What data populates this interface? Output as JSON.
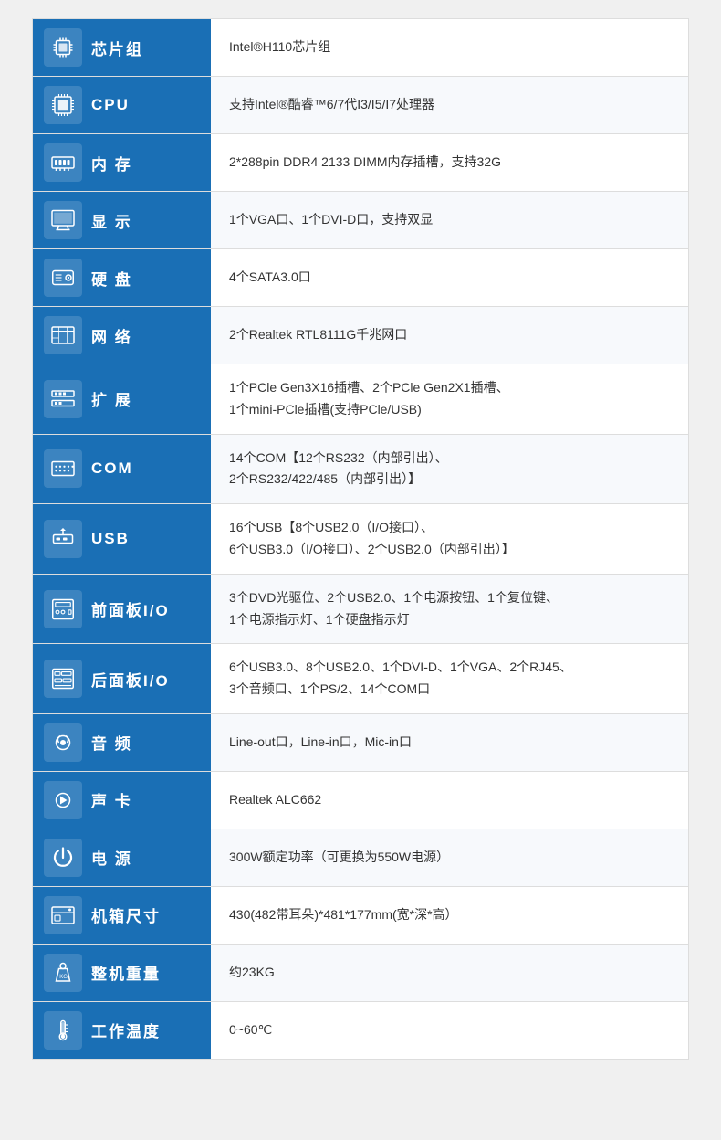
{
  "rows": [
    {
      "id": "chipset",
      "label": "芯片组",
      "value": "Intel®H110芯片组",
      "icon": "chipset"
    },
    {
      "id": "cpu",
      "label": "CPU",
      "value": "支持Intel®酷睿™6/7代I3/I5/I7处理器",
      "icon": "cpu"
    },
    {
      "id": "memory",
      "label": "内  存",
      "value": "2*288pin DDR4 2133 DIMM内存插槽，支持32G",
      "icon": "memory"
    },
    {
      "id": "display",
      "label": "显  示",
      "value": "1个VGA口、1个DVI-D口，支持双显",
      "icon": "display"
    },
    {
      "id": "hdd",
      "label": "硬  盘",
      "value": "4个SATA3.0口",
      "icon": "hdd"
    },
    {
      "id": "network",
      "label": "网  络",
      "value": "2个Realtek RTL8111G千兆网口",
      "icon": "network"
    },
    {
      "id": "expansion",
      "label": "扩  展",
      "value": "1个PCle Gen3X16插槽、2个PCle Gen2X1插槽、\n1个mini-PCle插槽(支持PCle/USB)",
      "icon": "expansion"
    },
    {
      "id": "com",
      "label": "COM",
      "value": "14个COM【12个RS232（内部引出）、\n2个RS232/422/485（内部引出）】",
      "icon": "com"
    },
    {
      "id": "usb",
      "label": "USB",
      "value": "16个USB【8个USB2.0（I/O接口）、\n6个USB3.0（I/O接口）、2个USB2.0（内部引出）】",
      "icon": "usb"
    },
    {
      "id": "front-panel",
      "label": "前面板I/O",
      "value": "3个DVD光驱位、2个USB2.0、1个电源按钮、1个复位键、\n1个电源指示灯、1个硬盘指示灯",
      "icon": "front-panel"
    },
    {
      "id": "rear-panel",
      "label": "后面板I/O",
      "value": "6个USB3.0、8个USB2.0、1个DVI-D、1个VGA、2个RJ45、\n3个音频口、1个PS/2、14个COM口",
      "icon": "rear-panel"
    },
    {
      "id": "audio",
      "label": "音  频",
      "value": "Line-out口，Line-in口，Mic-in口",
      "icon": "audio"
    },
    {
      "id": "sound-card",
      "label": "声  卡",
      "value": "Realtek ALC662",
      "icon": "sound-card"
    },
    {
      "id": "power",
      "label": "电  源",
      "value": "300W额定功率（可更换为550W电源）",
      "icon": "power"
    },
    {
      "id": "chassis",
      "label": "机箱尺寸",
      "value": "430(482带耳朵)*481*177mm(宽*深*高）",
      "icon": "chassis"
    },
    {
      "id": "weight",
      "label": "整机重量",
      "value": "约23KG",
      "icon": "weight"
    },
    {
      "id": "temperature",
      "label": "工作温度",
      "value": "0~60℃",
      "icon": "temperature"
    }
  ]
}
